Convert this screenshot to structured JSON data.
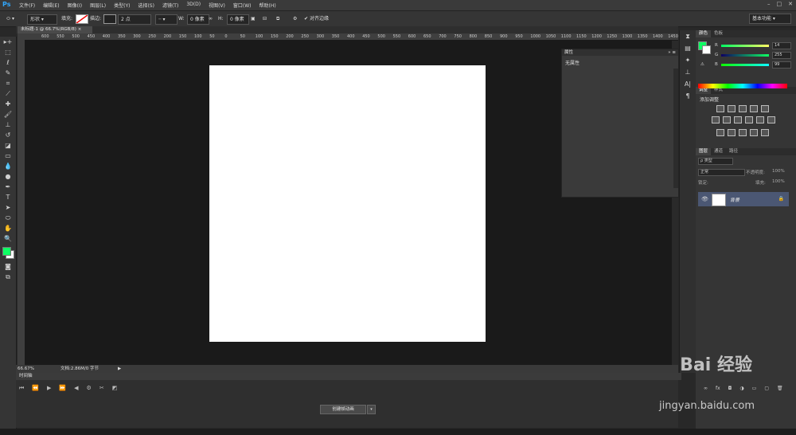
{
  "app": {
    "logo": "Ps"
  },
  "menu": [
    "文件(F)",
    "编辑(E)",
    "图像(I)",
    "图层(L)",
    "类型(Y)",
    "选择(S)",
    "滤镜(T)",
    "3D(D)",
    "视图(V)",
    "窗口(W)",
    "帮助(H)"
  ],
  "options": {
    "shape_mode": "形状",
    "fill_label": "填充:",
    "stroke_label": "描边:",
    "stroke_width": "2 点",
    "w_label": "W:",
    "w_value": "0 像素",
    "h_label": "H:",
    "h_value": "0 像素",
    "align_edges": "对齐边缘",
    "workspace": "基本功能"
  },
  "document": {
    "tab_title": "未标题-1 @ 66.7%(RGB/8)",
    "zoom": "66.67%",
    "doc_info": "文档:2.86M/0 字节"
  },
  "ruler_ticks": [
    "600",
    "550",
    "500",
    "450",
    "400",
    "350",
    "300",
    "250",
    "200",
    "150",
    "100",
    "50",
    "0",
    "50",
    "100",
    "150",
    "200",
    "250",
    "300",
    "350",
    "400",
    "450",
    "500",
    "550",
    "600",
    "650",
    "700",
    "750",
    "800",
    "850",
    "900",
    "950",
    "1000",
    "1050",
    "1100",
    "1150",
    "1200",
    "1250",
    "1300",
    "1350",
    "1400",
    "1450"
  ],
  "properties": {
    "title": "属性",
    "content": "无属性"
  },
  "timeline": {
    "title": "时间轴",
    "create_button": "创建帧动画"
  },
  "color_panel": {
    "tabs": [
      "颜色",
      "色板"
    ],
    "r_label": "R",
    "r_value": "14",
    "g_label": "G",
    "g_value": "255",
    "b_label": "B",
    "b_value": "99",
    "foreground": "#0eff63"
  },
  "adjust_panel": {
    "tabs": [
      "调整",
      "样式"
    ],
    "add_label": "添加调整"
  },
  "layers_panel": {
    "tabs": [
      "图层",
      "通道",
      "路径"
    ],
    "kind": "ρ 类型",
    "blend_mode": "正常",
    "opacity_label": "不透明度:",
    "opacity_value": "100%",
    "lock_label": "锁定:",
    "fill_label": "填充:",
    "fill_value": "100%",
    "layer_name": "背景"
  },
  "watermark": {
    "brand": "Bai 经验",
    "url": "jingyan.baidu.com"
  }
}
